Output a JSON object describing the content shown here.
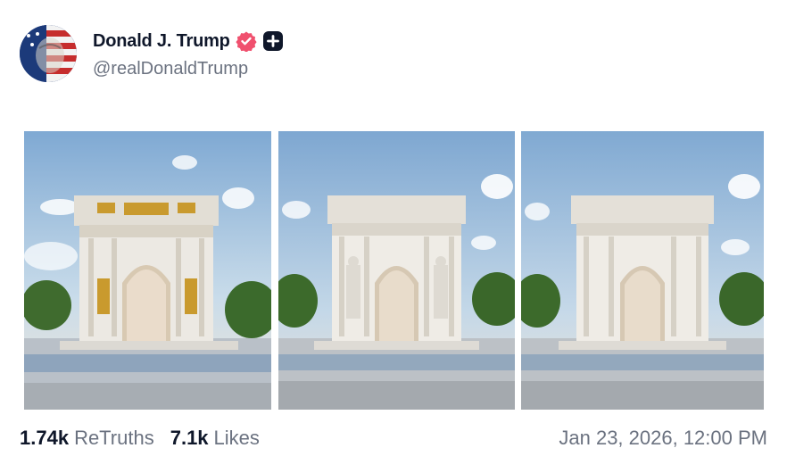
{
  "post": {
    "author_name": "Donald J. Trump",
    "handle": "@realDonaldTrump",
    "retruths_count": "1.74k",
    "retruths_label": "ReTruths",
    "likes_count": "7.1k",
    "likes_label": "Likes",
    "timestamp": "Jan 23, 2026, 12:00 PM"
  },
  "images": [
    {
      "variant": "gold-accented arch"
    },
    {
      "variant": "white arch with statues"
    },
    {
      "variant": "plain white arch"
    }
  ],
  "colors": {
    "verified_badge": "#f0506e",
    "sky": "#9fc0dd",
    "marble": "#e9e6df",
    "gold": "#c99a2e"
  }
}
